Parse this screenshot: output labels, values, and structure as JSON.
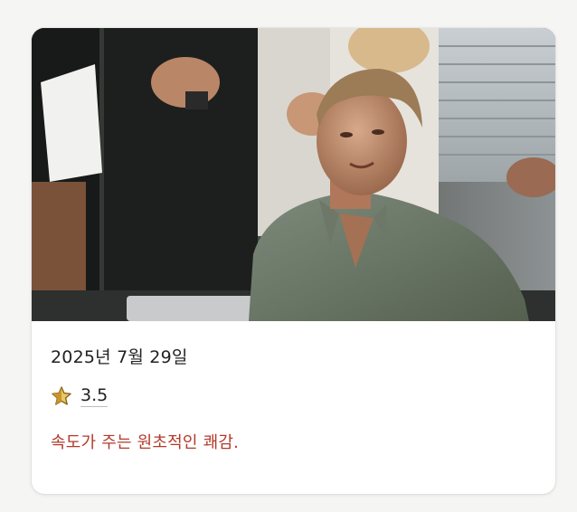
{
  "card": {
    "image_alt": "",
    "date": "2025년 7월 29일",
    "rating": {
      "icon": "half-star-icon",
      "value": "3.5"
    },
    "review": "속도가 주는 원초적인 쾌감."
  },
  "colors": {
    "background": "#f5f5f4",
    "card": "#ffffff",
    "review_text": "#b23a2a",
    "star_fill": "#c9962b",
    "star_outline": "#8a6414"
  }
}
